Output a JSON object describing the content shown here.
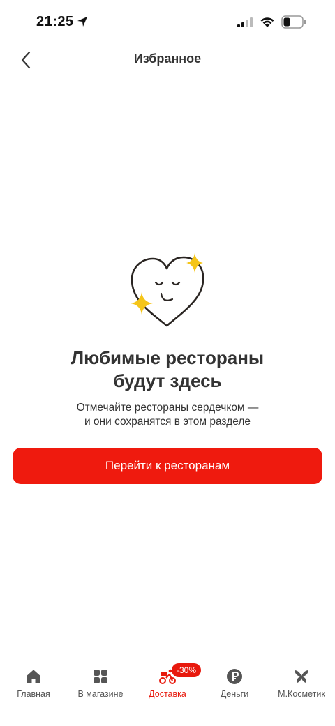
{
  "status_bar": {
    "time": "21:25"
  },
  "header": {
    "title": "Избранное"
  },
  "empty_state": {
    "title_line1": "Любимые рестораны",
    "title_line2": "будут здесь",
    "subtitle_line1": "Отмечайте рестораны сердечком —",
    "subtitle_line2": "и они сохранятся в этом разделе"
  },
  "cta": {
    "label": "Перейти к ресторанам"
  },
  "tab_bar": {
    "items": [
      {
        "label": "Главная",
        "icon": "home-icon",
        "active": false
      },
      {
        "label": "В магазине",
        "icon": "grid-icon",
        "active": false
      },
      {
        "label": "Доставка",
        "icon": "courier-icon",
        "active": true
      },
      {
        "label": "Деньги",
        "icon": "ruble-icon",
        "active": false
      },
      {
        "label": "М.Косметик",
        "icon": "butterfly-icon",
        "active": false
      }
    ],
    "promo_badge": "-30%"
  },
  "colors": {
    "accent": "#ef1a0e",
    "star": "#f5c518",
    "text": "#333333"
  }
}
